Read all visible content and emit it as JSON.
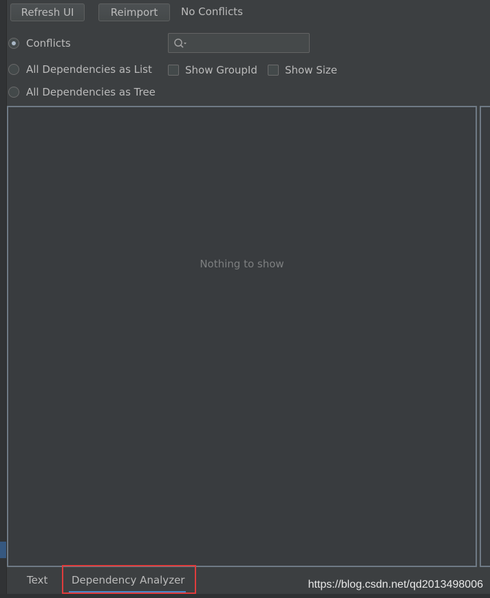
{
  "toolbar": {
    "refresh_label": "Refresh UI",
    "reimport_label": "Reimport",
    "status": "No Conflicts"
  },
  "view_options": {
    "conflicts": "Conflicts",
    "all_as_list": "All Dependencies as List",
    "all_as_tree": "All Dependencies as Tree",
    "selected": "Conflicts"
  },
  "search": {
    "placeholder": "",
    "value": ""
  },
  "checkboxes": {
    "show_groupid": "Show GroupId",
    "show_size": "Show Size"
  },
  "main_panel": {
    "empty_text": "Nothing to show"
  },
  "bottom_tabs": {
    "text_tab": "Text",
    "analyzer_tab": "Dependency Analyzer"
  },
  "watermark": "https://blog.csdn.net/qd2013498006",
  "colors": {
    "background": "#3c3f41",
    "panel_border": "#6f7a85",
    "highlight_box": "#e03c3c",
    "active_tab_underline": "#4a88c7"
  }
}
